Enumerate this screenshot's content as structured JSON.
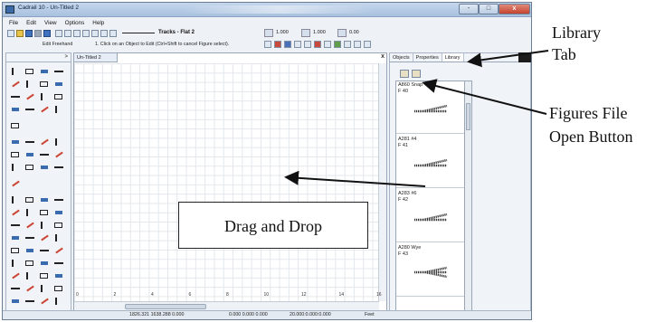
{
  "window": {
    "title": "Cadrail 10 - Un-Titled 2",
    "min_label": "-",
    "max_label": "□",
    "close_label": "x"
  },
  "menu": [
    "File",
    "Edit",
    "View",
    "Options",
    "Help"
  ],
  "toolbar": {
    "tracks_label": "Tracks - Flat 2",
    "scale1": "1.000",
    "scale2": "1.000",
    "angle": "0.00"
  },
  "toolbar2": {
    "mode": "Edit Freehand",
    "hint": "1. Click on an Object to Edit (Ctrl+Shift to cancel Figure select)."
  },
  "left_panel": {
    "collapse_glyph": ">"
  },
  "canvas": {
    "doc_tab": "Un-Titled 2",
    "close_glyph": "x",
    "x_ticks": [
      "0",
      "2",
      "4",
      "6",
      "8",
      "10",
      "12",
      "14",
      "16",
      "18"
    ],
    "y_ticks": [
      "12",
      "10",
      "8",
      "6",
      "4",
      "2"
    ]
  },
  "right_panel": {
    "tabs": [
      "Objects",
      "Properties",
      "Library"
    ],
    "active_tab": "Library",
    "items": [
      {
        "name": "A860 Snap",
        "figure": "F 40"
      },
      {
        "name": "A281 #4",
        "figure": "F 41"
      },
      {
        "name": "A283 #6",
        "figure": "F 42"
      },
      {
        "name": "A280 Wye",
        "figure": "F 43"
      }
    ]
  },
  "status": {
    "coords1": "1826.321 1638.288 0.000",
    "coords2": "0.000 0.000 0.000",
    "scale": "20.000:0.000:0.000",
    "units": "Feet"
  },
  "annotations": {
    "library_tab": "Library\nTab",
    "figures_button": "Figures File\nOpen Button",
    "drag_drop": "Drag and Drop"
  }
}
